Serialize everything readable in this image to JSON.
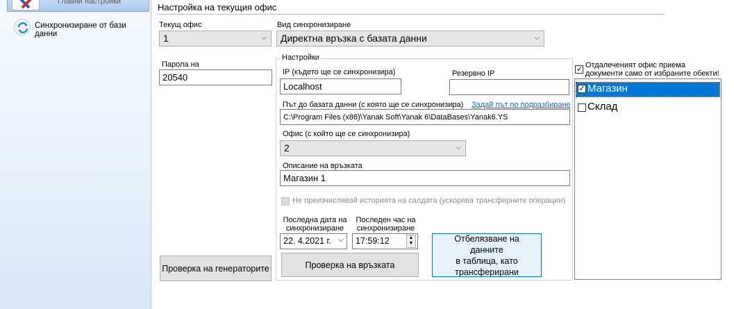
{
  "sidebar": {
    "items": [
      {
        "label": "Главни настройки",
        "icon": "tools-icon",
        "active": true
      },
      {
        "label": "Синхронизиране от бази данни",
        "icon": "sync-icon",
        "active": false
      }
    ]
  },
  "page": {
    "title": "Настройка на текущия офис"
  },
  "current_office": {
    "label": "Текущ офис",
    "value": "1"
  },
  "sync_type": {
    "label": "Вид синхронизиране",
    "value": "Директна връзка с базата данни"
  },
  "password": {
    "label": "Парола на",
    "value": "20540"
  },
  "settings": {
    "group_label": "Настройки",
    "ip_label": "IP (където ще се синхронизира)",
    "ip_value": "Localhost",
    "backup_ip_label": "Резервно IP",
    "backup_ip_value": "",
    "db_path_label": "Път до базата данни (с която ще се синхронизира)",
    "default_path_link": "Задай път по подразбиране",
    "db_path_value": "C:\\Program Files (x86)\\Yanak Soft\\Yanak 6\\DataBases\\Yanak6.YS",
    "office_label": "Офис (с който ще се синхронизира)",
    "office_value": "2",
    "description_label": "Описание на връзката",
    "description_value": "Магазин 1",
    "no_recalc_label": "Не преизчислявай историята на салдата (ускорява трансферните операции)",
    "last_date_label_1": "Последна дата на",
    "last_date_label_2": "синхронизиране",
    "last_date_value": "22.  4.2021 г.",
    "last_time_label_1": "Последен час на",
    "last_time_label_2": "синхронизиране",
    "last_time_value": "17:59:12"
  },
  "buttons": {
    "check_generators": "Проверка на генераторите",
    "check_connection": "Проверка на връзката",
    "mark_data_1": "Отбелязване на данните",
    "mark_data_2": "в таблица, като",
    "mark_data_3": "трансферирани"
  },
  "remote_office": {
    "checkbox_label_1": "Отдалеченият офис приема",
    "checkbox_label_2": "документи само от избраните обекти!",
    "checked": true,
    "objects": [
      {
        "label": "Магазин",
        "checked": true,
        "selected": true
      },
      {
        "label": "Склад",
        "checked": false,
        "selected": false
      }
    ]
  }
}
